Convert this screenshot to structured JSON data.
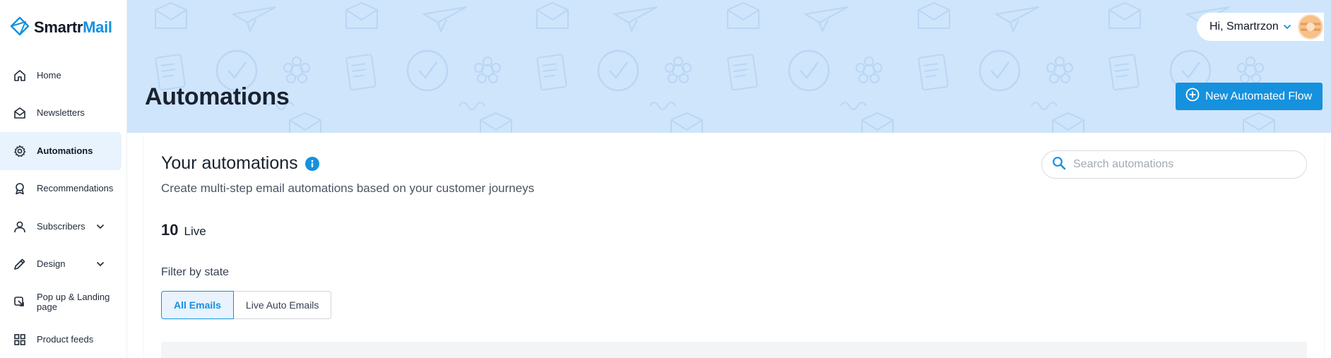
{
  "brand": {
    "name_part1": "Smartr",
    "name_part2": "Mail",
    "icon": "smartrmail-logo"
  },
  "sidebar": {
    "items": [
      {
        "label": "Home",
        "icon": "home-icon"
      },
      {
        "label": "Newsletters",
        "icon": "envelope-icon"
      },
      {
        "label": "Automations",
        "icon": "gear-icon",
        "active": true
      },
      {
        "label": "Recommendations",
        "icon": "award-icon"
      },
      {
        "label": "Subscribers",
        "icon": "user-icon",
        "expandable": true
      },
      {
        "label": "Design",
        "icon": "pencil-icon",
        "expandable": true
      },
      {
        "label": "Pop up & Landing page",
        "icon": "popup-icon"
      },
      {
        "label": "Product feeds",
        "icon": "grid-icon"
      }
    ]
  },
  "header": {
    "title": "Automations",
    "user_greeting": "Hi, Smartrzon",
    "avatar_icon": "avatar-icon",
    "new_flow_label": "New Automated Flow"
  },
  "main": {
    "card_title": "Your automations",
    "card_subtitle": "Create multi-step email automations based on your customer journeys",
    "live_count": "10",
    "live_label": "Live",
    "filter_label": "Filter by state",
    "filters": [
      {
        "label": "All Emails",
        "selected": true
      },
      {
        "label": "Live Auto Emails",
        "selected": false
      }
    ],
    "search_placeholder": "Search automations"
  },
  "colors": {
    "accent": "#1591de",
    "banner": "#cfe5fb",
    "active_bg": "#e8f3fd"
  }
}
